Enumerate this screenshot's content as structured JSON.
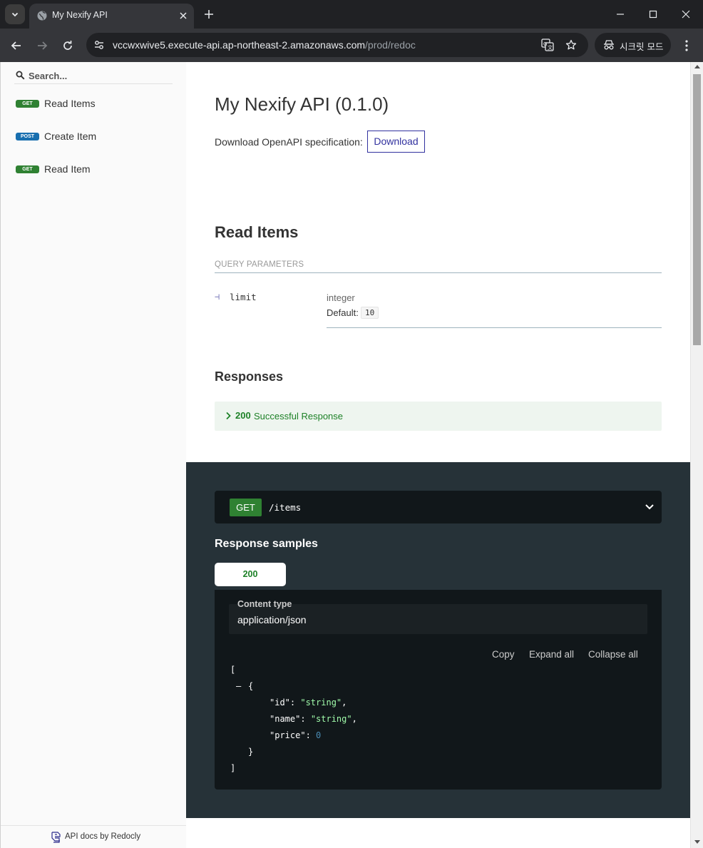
{
  "browser": {
    "tab_title": "My Nexify API",
    "url_host": "vccwxwive5.execute-api.ap-northeast-2.amazonaws.com",
    "url_path": "/prod/redoc",
    "incognito_label": "시크릿 모드"
  },
  "sidebar": {
    "search_placeholder": "Search...",
    "items": [
      {
        "method": "GET",
        "label": "Read Items"
      },
      {
        "method": "POST",
        "label": "Create Item"
      },
      {
        "method": "GET",
        "label": "Read Item"
      }
    ],
    "footer": "API docs by Redocly"
  },
  "main": {
    "api_title": "My Nexify API (0.1.0)",
    "download_text": "Download OpenAPI specification:",
    "download_button": "Download",
    "operation_title": "Read Items",
    "query_params_header": "QUERY PARAMETERS",
    "param": {
      "tree_glyph": "⊣",
      "name": "limit",
      "type": "integer",
      "default_label": "Default:",
      "default_value": "10"
    },
    "responses_title": "Responses",
    "response": {
      "code": "200",
      "description": "Successful Response"
    }
  },
  "right_panel": {
    "method": "GET",
    "path": "/items",
    "samples_title": "Response samples",
    "response_tab": "200",
    "content_type_label": "Content type",
    "content_type_value": "application/json",
    "actions": {
      "copy": "Copy",
      "expand_all": "Expand all",
      "collapse_all": "Collapse all"
    },
    "code": {
      "open_bracket": "[",
      "collapse_toggle": "–",
      "open_brace": "{",
      "fields": [
        {
          "key": "\"id\"",
          "value": "\"string\"",
          "value_type": "string",
          "trailing": ","
        },
        {
          "key": "\"name\"",
          "value": "\"string\"",
          "value_type": "string",
          "trailing": ","
        },
        {
          "key": "\"price\"",
          "value": "0",
          "value_type": "number",
          "trailing": ""
        }
      ],
      "close_brace": "}",
      "close_bracket": "]"
    }
  },
  "colors": {
    "get_badge": "#2f8132",
    "post_badge": "#186faf",
    "accent": "#32329f",
    "success": "#1d8127",
    "dark_panel": "#263238",
    "code_bg": "#11171a"
  }
}
